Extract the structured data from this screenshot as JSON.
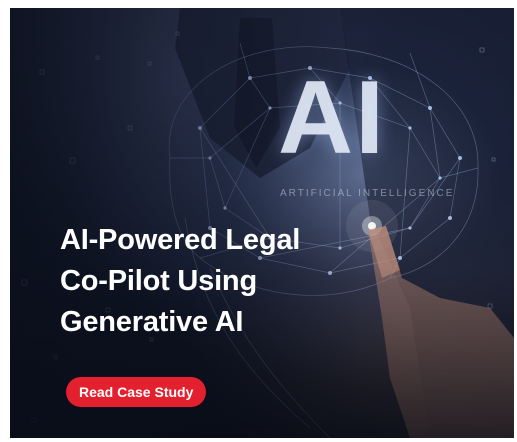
{
  "promo_card": {
    "hero_graphic": {
      "letters": "AI",
      "caption": "ARTIFICIAL INTELLIGENCE"
    },
    "headline": [
      "AI-Powered Legal",
      "Co-Pilot Using",
      "Generative AI"
    ],
    "cta_label": "Read Case Study"
  },
  "colors": {
    "cta_background": "#e3202e",
    "headline_text": "#ffffff",
    "background_dark": "#121a2c"
  }
}
